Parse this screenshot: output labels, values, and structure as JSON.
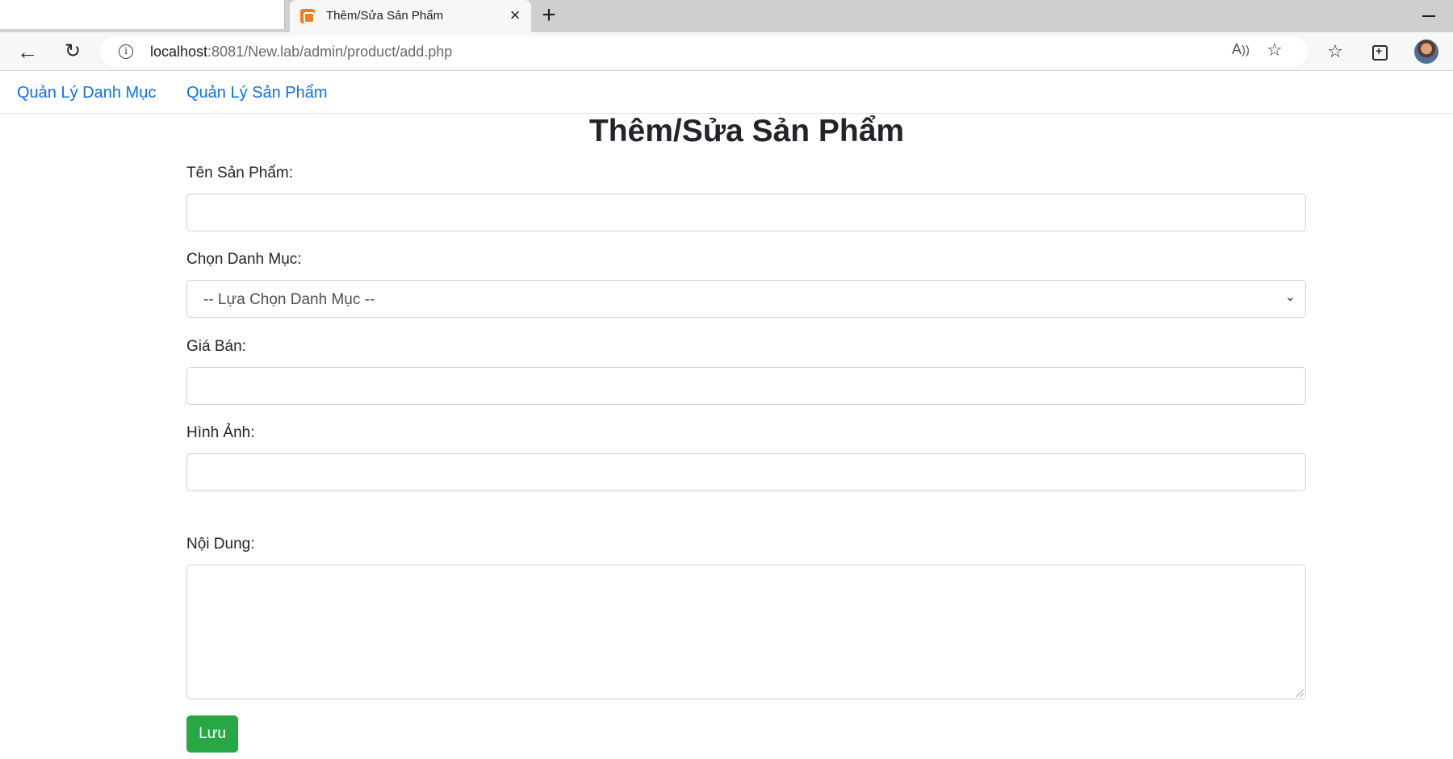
{
  "browser": {
    "tab_title": "Thêm/Sửa Sản Phẩm",
    "url_host": "localhost",
    "url_rest": ":8081/New.lab/admin/product/add.php",
    "icons": {
      "back": "arrow-left",
      "reload": "reload",
      "info": "info",
      "read_aloud": "read-aloud",
      "add_favorite": "star-plus",
      "favorites": "favorites",
      "collections": "collections",
      "profile": "avatar"
    }
  },
  "nav": {
    "items": [
      {
        "label": "Quản Lý Danh Mục"
      },
      {
        "label": "Quản Lý Sản Phẩm"
      }
    ]
  },
  "page": {
    "title": "Thêm/Sửa Sản Phẩm"
  },
  "form": {
    "name_label": "Tên Sản Phẩm:",
    "name_value": "",
    "category_label": "Chọn Danh Mục:",
    "category_selected": "-- Lựa Chọn Danh Mục --",
    "price_label": "Giá Bán:",
    "price_value": "",
    "image_label": "Hình Ảnh:",
    "image_value": "",
    "content_label": "Nội Dung:",
    "content_value": "",
    "save_label": "Lưu"
  },
  "colors": {
    "link": "#0d6efd",
    "save_button": "#28a745",
    "tab_favicon": "#f57c1f"
  }
}
